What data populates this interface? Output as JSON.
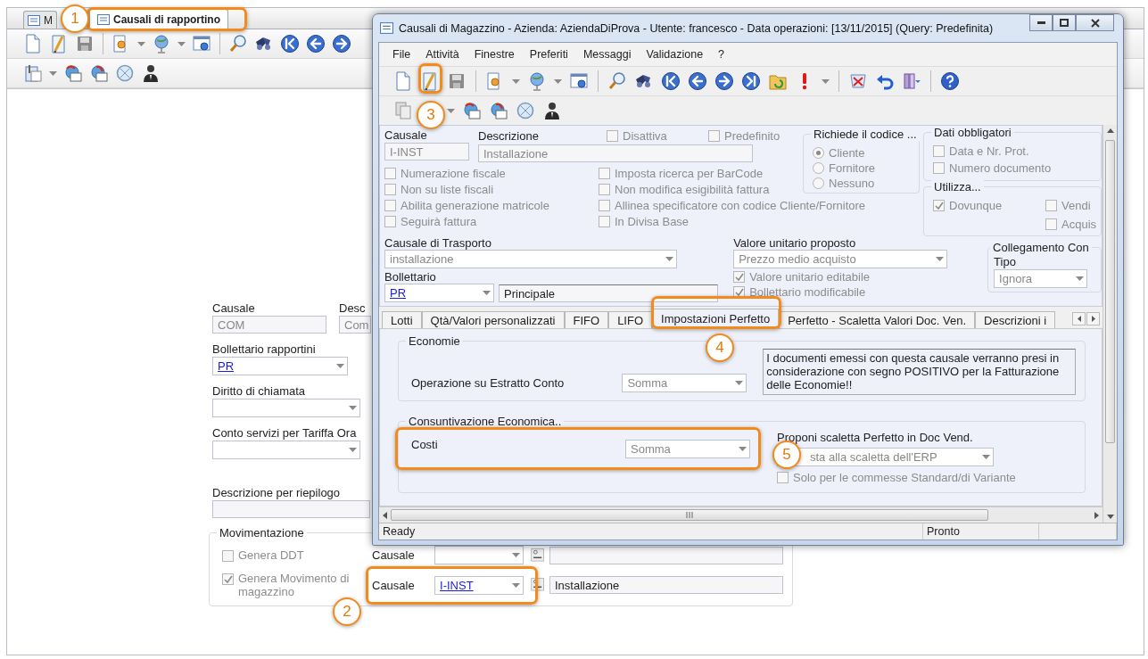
{
  "app": {
    "tabs": [
      {
        "label": "M",
        "selected": false
      },
      {
        "label": "Causali di rapportino",
        "selected": true
      }
    ]
  },
  "form": {
    "causale_label": "Causale",
    "causale_value": "COM",
    "descrizione_label": "Desc",
    "descrizione_value": "Com",
    "bollettario_label": "Bollettario rapportini",
    "bollettario_value": "PR",
    "diritto_label": "Diritto di chiamata",
    "conto_label": "Conto servizi per Tariffa Ora",
    "riepilogo_label": "Descrizione per riepilogo",
    "movimentazione": {
      "title": "Movimentazione",
      "rows": [
        {
          "label": "Genera DDT",
          "checked": false,
          "causale_label": "Causale"
        },
        {
          "label": "Genera Movimento di magazzino",
          "checked": true,
          "causale_label": "Causale",
          "causale_value": "I-INST",
          "description": "Installazione"
        }
      ]
    }
  },
  "dialog": {
    "title": "Causali di Magazzino - Azienda: AziendaDiProva - Utente: francesco - Data operazioni: [13/11/2015] (Query: Predefinita)",
    "menu": [
      "File",
      "Attività",
      "Finestre",
      "Preferiti",
      "Messaggi",
      "Validazione",
      "?"
    ],
    "causale": {
      "label": "Causale",
      "value": "I-INST"
    },
    "descrizione": {
      "label": "Descrizione",
      "value": "Installazione"
    },
    "header_checks": [
      {
        "label": "Disattiva",
        "checked": false
      },
      {
        "label": "Predefinito",
        "checked": false
      }
    ],
    "richiede": {
      "title": "Richiede il codice ...",
      "options": [
        {
          "label": "Cliente",
          "selected": true
        },
        {
          "label": "Fornitore",
          "selected": false
        },
        {
          "label": "Nessuno",
          "selected": false
        }
      ]
    },
    "dati_obbligatori": {
      "title": "Dati obbligatori",
      "options": [
        {
          "label": "Data e Nr. Prot.",
          "checked": false
        },
        {
          "label": "Numero documento",
          "checked": false
        }
      ]
    },
    "options_left": [
      {
        "label": "Numerazione fiscale",
        "checked": false
      },
      {
        "label": "Non su liste fiscali",
        "checked": false
      },
      {
        "label": "Abilita generazione matricole",
        "checked": false
      },
      {
        "label": "Seguirà fattura",
        "checked": false
      }
    ],
    "options_right": [
      {
        "label": "Imposta ricerca per BarCode",
        "checked": false
      },
      {
        "label": "Non modifica esigibilità fattura",
        "checked": false
      },
      {
        "label": "Allinea specificatore con codice Cliente/Fornitore",
        "checked": false
      },
      {
        "label": "In Divisa Base",
        "checked": false
      }
    ],
    "utilizza": {
      "title": "Utilizza...",
      "options": [
        {
          "label": "Dovunque",
          "checked": true
        },
        {
          "label": "Vendi",
          "checked": false
        },
        {
          "label": "Acquis",
          "checked": false
        }
      ]
    },
    "trasporto": {
      "label": "Causale di Trasporto",
      "value": "installazione"
    },
    "bollettario": {
      "label": "Bollettario",
      "value": "PR",
      "description": "Principale"
    },
    "valore": {
      "label": "Valore unitario proposto",
      "value": "Prezzo medio acquisto",
      "options": [
        {
          "label": "Valore unitario editabile",
          "checked": true
        },
        {
          "label": "Bollettario modificabile",
          "checked": true
        }
      ]
    },
    "collegamento": {
      "title": "Collegamento Con",
      "tipo_label": "Tipo",
      "tipo_value": "Ignora"
    },
    "tabs": [
      {
        "label": "Lotti",
        "selected": false
      },
      {
        "label": "Qtà/Valori personalizzati",
        "selected": false
      },
      {
        "label": "FIFO",
        "selected": false
      },
      {
        "label": "LIFO",
        "selected": false
      },
      {
        "label": "Impostazioni Perfetto",
        "selected": true
      },
      {
        "label": "Perfetto - Scaletta Valori Doc. Ven.",
        "selected": false
      },
      {
        "label": "Descrizioni i",
        "selected": false
      }
    ],
    "economie": {
      "title": "Economie",
      "operazione_label": "Operazione su Estratto Conto",
      "operazione_value": "Somma",
      "note": "I documenti emessi con questa causale verranno presi in considerazione con segno POSITIVO per la Fatturazione delle Economie!!"
    },
    "consuntivazione": {
      "title": "Consuntivazione Economica..",
      "costi_label": "Costi",
      "costi_value": "Somma",
      "proponi_label": "Proponi scaletta Perfetto in Doc Vend.",
      "proponi_value": "sta alla scaletta dell'ERP",
      "solo": {
        "label": "Solo per le commesse Standard/di Variante",
        "checked": false
      }
    },
    "status": [
      "Ready",
      "Pronto"
    ]
  },
  "callouts": [
    "1",
    "2",
    "3",
    "4",
    "5"
  ]
}
